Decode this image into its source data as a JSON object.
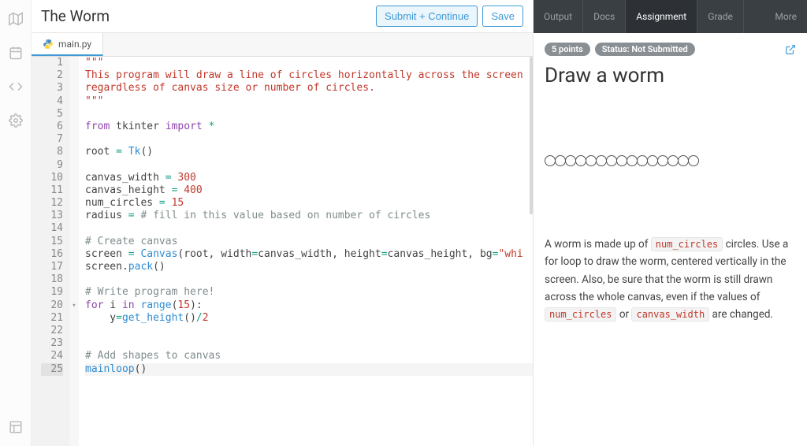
{
  "header": {
    "title": "The Worm",
    "submit_label": "Submit + Continue",
    "save_label": "Save"
  },
  "file_tab": {
    "name": "main.py"
  },
  "left_rail_icons": [
    "map-icon",
    "calendar-icon",
    "code-icon",
    "gear-icon"
  ],
  "code": {
    "lines": [
      {
        "n": 1,
        "tokens": [
          {
            "t": "\"\"\"",
            "c": "tok-str"
          }
        ]
      },
      {
        "n": 2,
        "tokens": [
          {
            "t": "This program will draw a line of circles horizontally across the screen",
            "c": "tok-str"
          }
        ]
      },
      {
        "n": 3,
        "tokens": [
          {
            "t": "regardless of canvas size or number of circles.",
            "c": "tok-str"
          }
        ]
      },
      {
        "n": 4,
        "tokens": [
          {
            "t": "\"\"\"",
            "c": "tok-str"
          }
        ]
      },
      {
        "n": 5,
        "tokens": []
      },
      {
        "n": 6,
        "tokens": [
          {
            "t": "from",
            "c": "tok-kw"
          },
          {
            "t": " tkinter "
          },
          {
            "t": "import",
            "c": "tok-kw"
          },
          {
            "t": " "
          },
          {
            "t": "*",
            "c": "tok-op"
          }
        ]
      },
      {
        "n": 7,
        "tokens": []
      },
      {
        "n": 8,
        "tokens": [
          {
            "t": "root "
          },
          {
            "t": "=",
            "c": "tok-op"
          },
          {
            "t": " "
          },
          {
            "t": "Tk",
            "c": "tok-fn"
          },
          {
            "t": "()"
          }
        ]
      },
      {
        "n": 9,
        "tokens": []
      },
      {
        "n": 10,
        "tokens": [
          {
            "t": "canvas_width "
          },
          {
            "t": "=",
            "c": "tok-op"
          },
          {
            "t": " "
          },
          {
            "t": "300",
            "c": "tok-num"
          }
        ]
      },
      {
        "n": 11,
        "tokens": [
          {
            "t": "canvas_height "
          },
          {
            "t": "=",
            "c": "tok-op"
          },
          {
            "t": " "
          },
          {
            "t": "400",
            "c": "tok-num"
          }
        ]
      },
      {
        "n": 12,
        "tokens": [
          {
            "t": "num_circles "
          },
          {
            "t": "=",
            "c": "tok-op"
          },
          {
            "t": " "
          },
          {
            "t": "15",
            "c": "tok-num"
          }
        ]
      },
      {
        "n": 13,
        "tokens": [
          {
            "t": "radius "
          },
          {
            "t": "=",
            "c": "tok-op"
          },
          {
            "t": " "
          },
          {
            "t": "# fill in this value based on number of circles",
            "c": "tok-cm"
          }
        ]
      },
      {
        "n": 14,
        "tokens": []
      },
      {
        "n": 15,
        "tokens": [
          {
            "t": "# Create canvas",
            "c": "tok-cm"
          }
        ]
      },
      {
        "n": 16,
        "tokens": [
          {
            "t": "screen "
          },
          {
            "t": "=",
            "c": "tok-op"
          },
          {
            "t": " "
          },
          {
            "t": "Canvas",
            "c": "tok-fn"
          },
          {
            "t": "(root, width"
          },
          {
            "t": "=",
            "c": "tok-op"
          },
          {
            "t": "canvas_width, height"
          },
          {
            "t": "=",
            "c": "tok-op"
          },
          {
            "t": "canvas_height, bg"
          },
          {
            "t": "=",
            "c": "tok-op"
          },
          {
            "t": "\"whi",
            "c": "tok-str"
          }
        ]
      },
      {
        "n": 17,
        "tokens": [
          {
            "t": "screen."
          },
          {
            "t": "pack",
            "c": "tok-fn"
          },
          {
            "t": "()"
          }
        ]
      },
      {
        "n": 18,
        "tokens": []
      },
      {
        "n": 19,
        "tokens": [
          {
            "t": "# Write program here!",
            "c": "tok-cm"
          }
        ]
      },
      {
        "n": 20,
        "tokens": [
          {
            "t": "for",
            "c": "tok-kw"
          },
          {
            "t": " i "
          },
          {
            "t": "in",
            "c": "tok-kw"
          },
          {
            "t": " "
          },
          {
            "t": "range",
            "c": "tok-fn"
          },
          {
            "t": "("
          },
          {
            "t": "15",
            "c": "tok-num"
          },
          {
            "t": "):"
          }
        ],
        "fold": true
      },
      {
        "n": 21,
        "tokens": [
          {
            "t": "    y"
          },
          {
            "t": "=",
            "c": "tok-op"
          },
          {
            "t": "get_height",
            "c": "tok-fn"
          },
          {
            "t": "()"
          },
          {
            "t": "/",
            "c": "tok-op"
          },
          {
            "t": "2",
            "c": "tok-num"
          }
        ]
      },
      {
        "n": 22,
        "tokens": []
      },
      {
        "n": 23,
        "tokens": []
      },
      {
        "n": 24,
        "tokens": [
          {
            "t": "# Add shapes to canvas",
            "c": "tok-cm"
          }
        ]
      },
      {
        "n": 25,
        "tokens": [
          {
            "t": "mainloop",
            "c": "tok-fn"
          },
          {
            "t": "()"
          }
        ],
        "hl": true
      }
    ]
  },
  "right_tabs": [
    {
      "label": "Output",
      "active": false
    },
    {
      "label": "Docs",
      "active": false
    },
    {
      "label": "Assignment",
      "active": true
    },
    {
      "label": "Grade",
      "active": false
    },
    {
      "label": "More",
      "active": false
    }
  ],
  "assignment": {
    "points_badge": "5 points",
    "status_badge": "Status: Not Submitted",
    "title": "Draw a worm",
    "worm_count": 15,
    "desc_parts": {
      "p1": "A worm is made up of ",
      "code1": "num_circles",
      "p2": " circles. Use a for loop to draw the worm, centered vertically in the screen. Also, be sure that the worm is still drawn across the whole canvas, even if the values of ",
      "code2": "num_circles",
      "p3": " or ",
      "code3": "canvas_width",
      "p4": " are changed."
    }
  }
}
